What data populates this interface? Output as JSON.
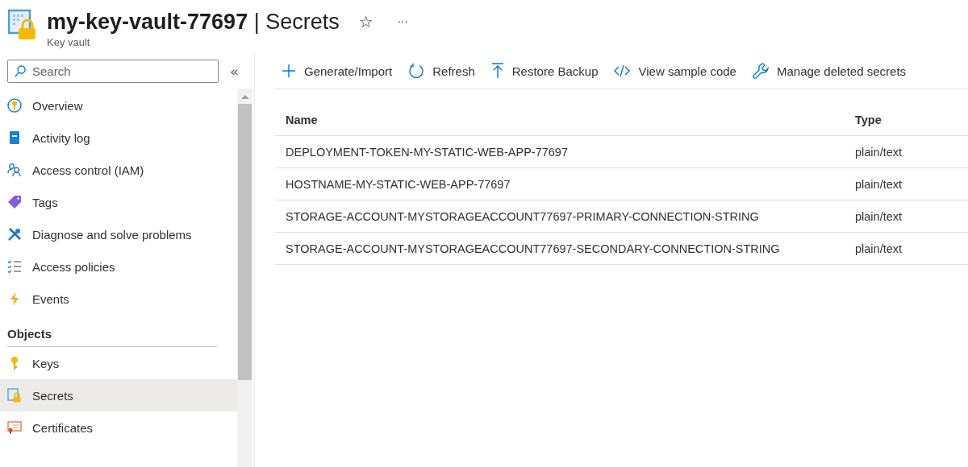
{
  "header": {
    "title": "**my-key-vault-77697** | Secrets",
    "subtitle": "Key vault",
    "favorite": "☆",
    "more": "···"
  },
  "sidebar": {
    "search": {
      "placeholder": "Search"
    },
    "collapse": "«",
    "items": [
      {
        "kind": "overview",
        "label": "Overview",
        "selected": false
      },
      {
        "kind": "activity-log",
        "label": "Activity log",
        "selected": false
      },
      {
        "kind": "access-control",
        "label": "Access control (IAM)",
        "selected": false
      },
      {
        "kind": "tags",
        "label": "Tags",
        "selected": false
      },
      {
        "kind": "diagnose",
        "label": "Diagnose and solve problems",
        "selected": false
      },
      {
        "kind": "access-policies",
        "label": "Access policies",
        "selected": false
      },
      {
        "kind": "events",
        "label": "Events",
        "selected": false
      },
      {
        "kind": "section",
        "label": "Objects"
      },
      {
        "kind": "keys",
        "label": "Keys",
        "selected": false
      },
      {
        "kind": "secrets",
        "label": "Secrets",
        "selected": true
      },
      {
        "kind": "certificates",
        "label": "Certificates",
        "selected": false
      }
    ]
  },
  "toolbar": [
    {
      "kind": "add",
      "label": "Generate/Import"
    },
    {
      "kind": "refresh",
      "label": "Refresh"
    },
    {
      "kind": "upload",
      "label": "Restore Backup"
    },
    {
      "kind": "code",
      "label": "View sample code"
    },
    {
      "kind": "wrench",
      "label": "Manage deleted secrets"
    }
  ],
  "table": {
    "columns": [
      "Name",
      "Type"
    ],
    "rows": [
      [
        "DEPLOYMENT-TOKEN-MY-STATIC-WEB-APP-77697",
        "plain/text"
      ],
      [
        "HOSTNAME-MY-STATIC-WEB-APP-77697",
        "plain/text"
      ],
      [
        "STORAGE-ACCOUNT-MYSTORAGEACCOUNT77697-PRIMARY-CONNECTION-STRING",
        "plain/text"
      ],
      [
        "STORAGE-ACCOUNT-MYSTORAGEACCOUNT77697-SECONDARY-CONNECTION-STRING",
        "plain/text"
      ]
    ]
  }
}
